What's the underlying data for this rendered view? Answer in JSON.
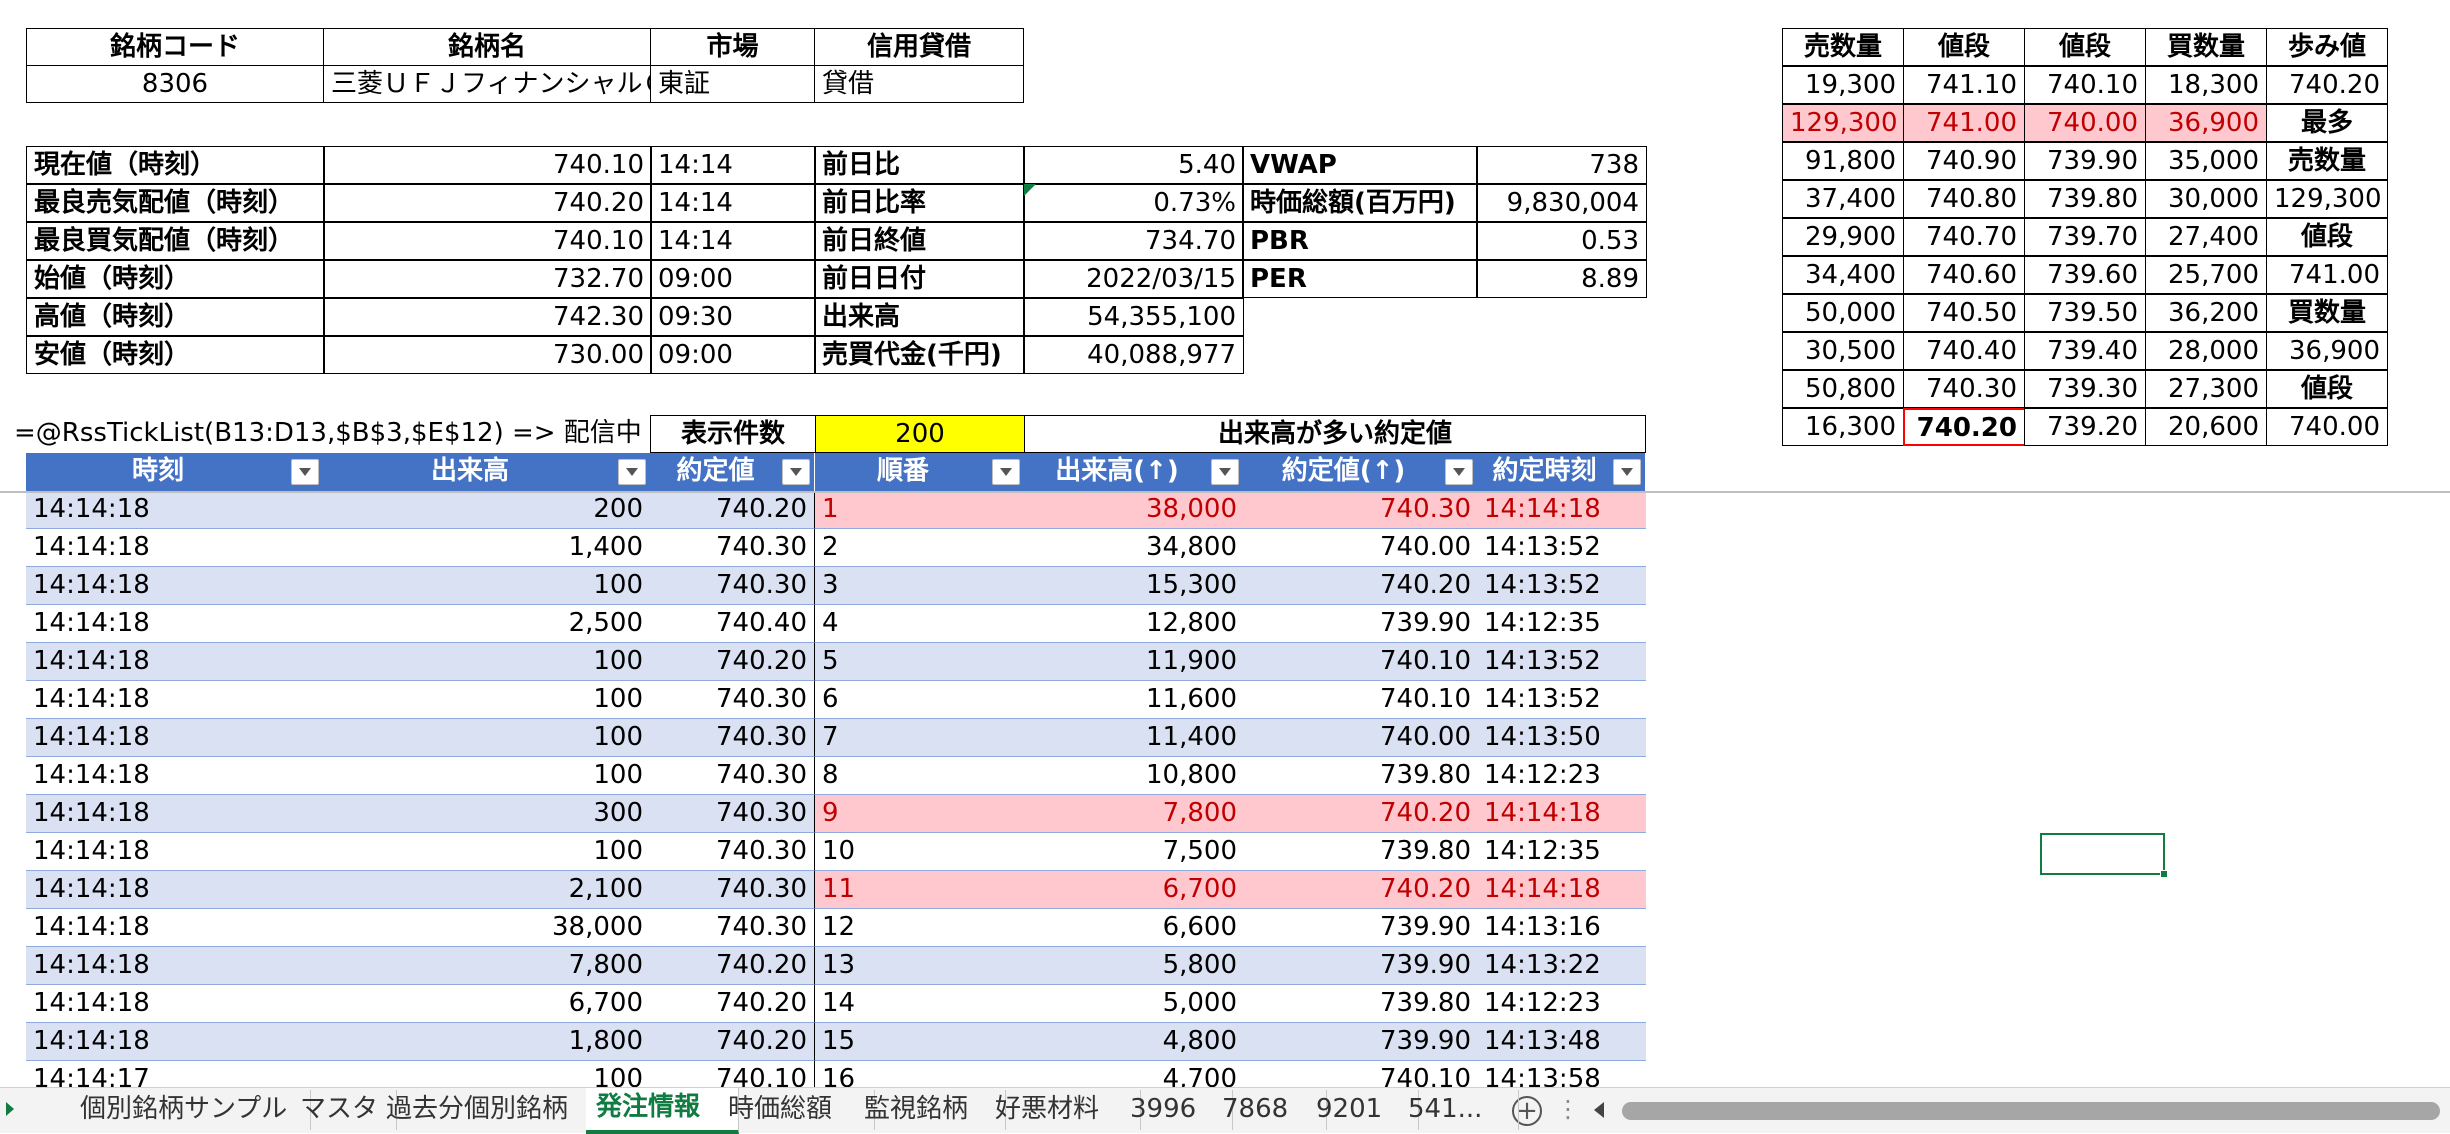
{
  "info": {
    "headers": [
      "銘柄コード",
      "銘柄名",
      "市場",
      "信用貸借"
    ],
    "values": [
      "8306",
      "三菱ＵＦＪフィナンシャルＧ",
      "東証",
      "貸借"
    ]
  },
  "quote": [
    [
      "現在値（時刻）",
      "740.10",
      "14:14",
      "前日比",
      "5.40",
      "VWAP",
      "738"
    ],
    [
      "最良売気配値（時刻）",
      "740.20",
      "14:14",
      "前日比率",
      "0.73%",
      "時価総額(百万円)",
      "9,830,004"
    ],
    [
      "最良買気配値（時刻）",
      "740.10",
      "14:14",
      "前日終値",
      "734.70",
      "PBR",
      "0.53"
    ],
    [
      "始値（時刻）",
      "732.70",
      "09:00",
      "前日日付",
      "2022/03/15",
      "PER",
      "8.89"
    ],
    [
      "高値（時刻）",
      "742.30",
      "09:30",
      "出来高",
      "54,355,100"
    ],
    [
      "安値（時刻）",
      "730.00",
      "09:00",
      "売買代金(千円)",
      "40,088,977"
    ]
  ],
  "board": {
    "headers": [
      "売数量",
      "値段",
      "値段",
      "買数量",
      "歩み値"
    ],
    "rows": [
      [
        "19,300",
        "741.10",
        "740.10",
        "18,300",
        "740.20"
      ],
      [
        "129,300",
        "741.00",
        "740.00",
        "36,900",
        "最多"
      ],
      [
        "91,800",
        "740.90",
        "739.90",
        "35,000",
        "売数量"
      ],
      [
        "37,400",
        "740.80",
        "739.80",
        "30,000",
        "129,300"
      ],
      [
        "29,900",
        "740.70",
        "739.70",
        "27,400",
        "値段"
      ],
      [
        "34,400",
        "740.60",
        "739.60",
        "25,700",
        "741.00"
      ],
      [
        "50,000",
        "740.50",
        "739.50",
        "36,200",
        "買数量"
      ],
      [
        "30,500",
        "740.40",
        "739.40",
        "28,000",
        "36,900"
      ],
      [
        "50,800",
        "740.30",
        "739.30",
        "27,300",
        "値段"
      ],
      [
        "16,300",
        "740.20",
        "739.20",
        "20,600",
        "740.00"
      ]
    ]
  },
  "formula_text": "=@RssTickList(B13:D13,$B$3,$E$12) => 配信中",
  "display_count_label": "表示件数",
  "display_count_value": "200",
  "top_label": "出来高が多い約定値",
  "tick_headers": [
    "時刻",
    "出来高",
    "約定値"
  ],
  "rank_headers": [
    "順番",
    "出来高(↑)",
    "約定値(↑)",
    "約定時刻"
  ],
  "ticks": [
    [
      "14:14:18",
      "200",
      "740.20"
    ],
    [
      "14:14:18",
      "1,400",
      "740.30"
    ],
    [
      "14:14:18",
      "100",
      "740.30"
    ],
    [
      "14:14:18",
      "2,500",
      "740.40"
    ],
    [
      "14:14:18",
      "100",
      "740.20"
    ],
    [
      "14:14:18",
      "100",
      "740.30"
    ],
    [
      "14:14:18",
      "100",
      "740.30"
    ],
    [
      "14:14:18",
      "100",
      "740.30"
    ],
    [
      "14:14:18",
      "300",
      "740.30"
    ],
    [
      "14:14:18",
      "100",
      "740.30"
    ],
    [
      "14:14:18",
      "2,100",
      "740.30"
    ],
    [
      "14:14:18",
      "38,000",
      "740.30"
    ],
    [
      "14:14:18",
      "7,800",
      "740.20"
    ],
    [
      "14:14:18",
      "6,700",
      "740.20"
    ],
    [
      "14:14:18",
      "1,800",
      "740.20"
    ],
    [
      "14:14:17",
      "100",
      "740.10"
    ]
  ],
  "ranks": [
    [
      "1",
      "38,000",
      "740.30",
      "14:14:18"
    ],
    [
      "2",
      "34,800",
      "740.00",
      "14:13:52"
    ],
    [
      "3",
      "15,300",
      "740.20",
      "14:13:52"
    ],
    [
      "4",
      "12,800",
      "739.90",
      "14:12:35"
    ],
    [
      "5",
      "11,900",
      "740.10",
      "14:13:52"
    ],
    [
      "6",
      "11,600",
      "740.10",
      "14:13:52"
    ],
    [
      "7",
      "11,400",
      "740.00",
      "14:13:50"
    ],
    [
      "8",
      "10,800",
      "739.80",
      "14:12:23"
    ],
    [
      "9",
      "7,800",
      "740.20",
      "14:14:18"
    ],
    [
      "10",
      "7,500",
      "739.80",
      "14:12:35"
    ],
    [
      "11",
      "6,700",
      "740.20",
      "14:14:18"
    ],
    [
      "12",
      "6,600",
      "739.90",
      "14:13:16"
    ],
    [
      "13",
      "5,800",
      "739.90",
      "14:13:22"
    ],
    [
      "14",
      "5,000",
      "739.80",
      "14:12:23"
    ],
    [
      "15",
      "4,800",
      "739.90",
      "14:13:48"
    ],
    [
      "16",
      "4,700",
      "740.10",
      "14:13:58"
    ]
  ],
  "tabs": [
    "個別銘柄サンプル",
    "マスタ",
    "過去分個別銘柄",
    "発注情報",
    "時価総額",
    "監視銘柄",
    "好悪材料",
    "3996",
    "7868",
    "9201",
    "541..."
  ],
  "colors": {
    "header_blue": "#4472c4",
    "band_blue": "#d9e1f2",
    "highlight_pink": "#ffc7ce",
    "highlight_yellow": "#ffff00",
    "red_text": "#c00000",
    "active_tab": "#107c41"
  }
}
